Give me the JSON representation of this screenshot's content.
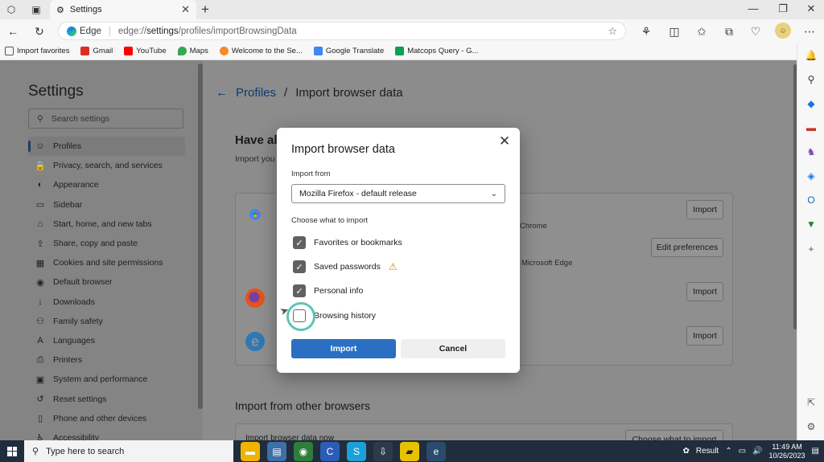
{
  "browser": {
    "tab_title": "Settings",
    "address_prefix": "Edge",
    "url_scheme": "edge://",
    "url_host": "settings",
    "url_path": "/profiles/importBrowsingData"
  },
  "favorites": [
    {
      "label": "Import favorites",
      "color": "#555555"
    },
    {
      "label": "Gmail",
      "color": "#d93025"
    },
    {
      "label": "YouTube",
      "color": "#ff0000"
    },
    {
      "label": "Maps",
      "color": "#34a853"
    },
    {
      "label": "Welcome to the Se...",
      "color": "#f28c28"
    },
    {
      "label": "Google Translate",
      "color": "#4285f4"
    },
    {
      "label": "Matcops Query - G...",
      "color": "#0f9d58"
    }
  ],
  "settings": {
    "title": "Settings",
    "search_placeholder": "Search settings",
    "nav": [
      {
        "label": "Profiles",
        "icon": "profile-icon",
        "glyph": "☺",
        "active": true
      },
      {
        "label": "Privacy, search, and services",
        "icon": "lock-icon",
        "glyph": "🔒",
        "active": false
      },
      {
        "label": "Appearance",
        "icon": "appearance-icon",
        "glyph": "◐",
        "active": false
      },
      {
        "label": "Sidebar",
        "icon": "sidebar-icon",
        "glyph": "▭",
        "active": false
      },
      {
        "label": "Start, home, and new tabs",
        "icon": "home-icon",
        "glyph": "⌂",
        "active": false
      },
      {
        "label": "Share, copy and paste",
        "icon": "share-icon",
        "glyph": "⇪",
        "active": false
      },
      {
        "label": "Cookies and site permissions",
        "icon": "cookie-icon",
        "glyph": "▦",
        "active": false
      },
      {
        "label": "Default browser",
        "icon": "browser-icon",
        "glyph": "◉",
        "active": false
      },
      {
        "label": "Downloads",
        "icon": "download-icon",
        "glyph": "↓",
        "active": false
      },
      {
        "label": "Family safety",
        "icon": "family-icon",
        "glyph": "⚇",
        "active": false
      },
      {
        "label": "Languages",
        "icon": "language-icon",
        "glyph": "A",
        "active": false
      },
      {
        "label": "Printers",
        "icon": "printer-icon",
        "glyph": "⎙",
        "active": false
      },
      {
        "label": "System and performance",
        "icon": "system-icon",
        "glyph": "▣",
        "active": false
      },
      {
        "label": "Reset settings",
        "icon": "reset-icon",
        "glyph": "↺",
        "active": false
      },
      {
        "label": "Phone and other devices",
        "icon": "phone-icon",
        "glyph": "▯",
        "active": false
      },
      {
        "label": "Accessibility",
        "icon": "accessibility-icon",
        "glyph": "♿",
        "active": false
      }
    ]
  },
  "content": {
    "breadcrumb_link": "Profiles",
    "breadcrumb_sep": "/",
    "breadcrumb_current": "Import browser data",
    "have_title": "Have al",
    "have_sub": "Import you",
    "frag_chrome": "Chrome",
    "frag_edge": "Microsoft Edge",
    "btn_import": "Import",
    "btn_edit_prefs": "Edit preferences",
    "other_title": "Import from other browsers",
    "other_row": "Import browser data now",
    "other_btn": "Choose what to import"
  },
  "dialog": {
    "title": "Import browser data",
    "import_from_label": "Import from",
    "import_from_value": "Mozilla Firefox - default release",
    "choose_label": "Choose what to import",
    "options": [
      {
        "label": "Favorites or bookmarks",
        "checked": true,
        "warning": false
      },
      {
        "label": "Saved passwords",
        "checked": true,
        "warning": true
      },
      {
        "label": "Personal info",
        "checked": true,
        "warning": false
      },
      {
        "label": "Browsing history",
        "checked": false,
        "warning": false
      }
    ],
    "import_button": "Import",
    "cancel_button": "Cancel"
  },
  "taskbar": {
    "search_placeholder": "Type here to search",
    "result_label": "Result",
    "time": "11:49 AM",
    "date": "10/26/2023"
  }
}
